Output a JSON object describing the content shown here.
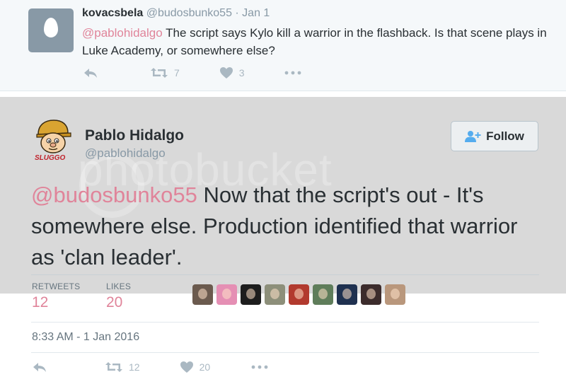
{
  "reply": {
    "name": "kovacsbela",
    "meta": "@budosbunko55 · Jan 1",
    "mention": "@pablohidalgo",
    "text": " The script says Kylo kill a warrior in the flashback. Is that scene plays in Luke Academy, or somewhere else?",
    "retweets": "7",
    "likes": "3"
  },
  "tweet": {
    "name": "Pablo Hidalgo",
    "handle": "@pablohidalgo",
    "follow_label": "Follow",
    "mention": "@budosbunko55",
    "text": " Now that the script's out - It's somewhere else. Production identified that warrior as 'clan leader'.",
    "retweets_label": "RETWEETS",
    "retweets_count": "12",
    "likes_label": "LIKES",
    "likes_count": "20",
    "timestamp": "8:33 AM - 1 Jan 2016",
    "action_retweets": "12",
    "action_likes": "20"
  },
  "colors": {
    "mention": "#e0849a",
    "action_icon": "#aab8c2",
    "band": "#d9d9d9"
  },
  "icons": [
    "reply-icon",
    "retweet-icon",
    "heart-icon",
    "more-icon",
    "follow-person-icon"
  ],
  "liker_colors": [
    "#6b5a4e",
    "#e58fb4",
    "#1d1d1d",
    "#8d8f7a",
    "#b23a2e",
    "#5f7d5a",
    "#1f3150",
    "#3c2c2c",
    "#b9977c"
  ]
}
